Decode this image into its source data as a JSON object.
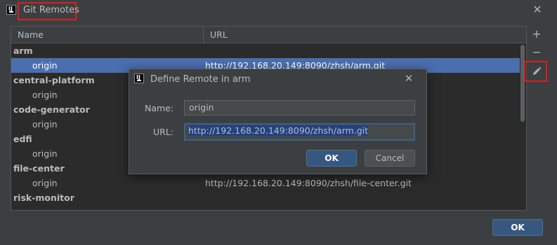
{
  "window": {
    "title": "Git Remotes",
    "logo_letter": "IJ",
    "close_icon": "close-icon",
    "highlight_color": "#e01c1c"
  },
  "table": {
    "columns": [
      "Name",
      "URL"
    ],
    "rows": [
      {
        "type": "group",
        "name": "arm",
        "url": ""
      },
      {
        "type": "remote",
        "name": "origin",
        "url": "http://192.168.20.149:8090/zhsh/arm.git",
        "selected": true
      },
      {
        "type": "group",
        "name": "central-platform",
        "url": ""
      },
      {
        "type": "remote",
        "name": "origin",
        "url": ""
      },
      {
        "type": "group",
        "name": "code-generator",
        "url": ""
      },
      {
        "type": "remote",
        "name": "origin",
        "url": ""
      },
      {
        "type": "group",
        "name": "edfi",
        "url": ""
      },
      {
        "type": "remote",
        "name": "origin",
        "url": ""
      },
      {
        "type": "group",
        "name": "file-center",
        "url": ""
      },
      {
        "type": "remote",
        "name": "origin",
        "url": "http://192.168.20.149:8090/zhsh/file-center.git"
      },
      {
        "type": "group",
        "name": "risk-monitor",
        "url": ""
      },
      {
        "type": "remote",
        "name": "",
        "url": ""
      }
    ]
  },
  "toolbar": {
    "add_label": "+",
    "remove_label": "−",
    "edit_icon": "pencil-icon"
  },
  "footer": {
    "ok_label": "OK"
  },
  "dialog": {
    "title": "Define Remote in arm",
    "name_label": "Name:",
    "name_value": "origin",
    "url_label": "URL:",
    "url_value": "http://192.168.20.149:8090/zhsh/arm.git",
    "ok_label": "OK",
    "cancel_label": "Cancel"
  }
}
